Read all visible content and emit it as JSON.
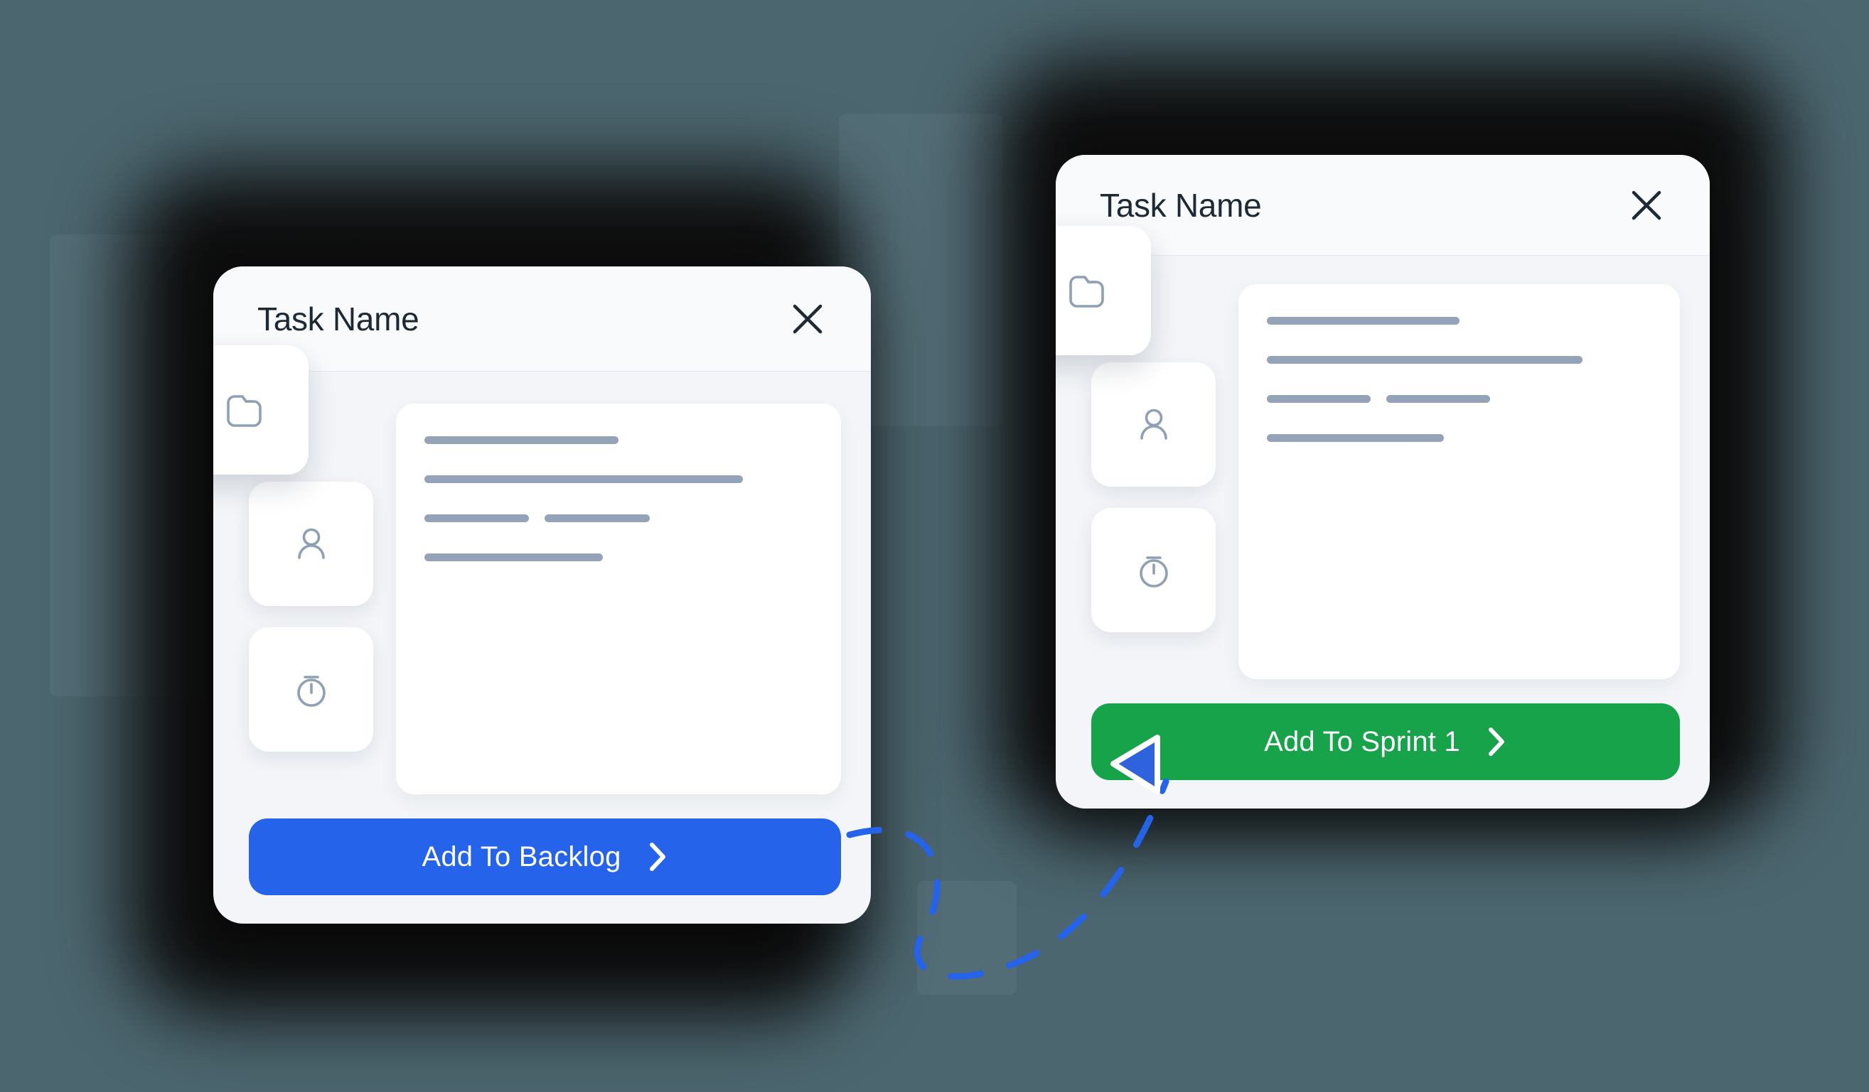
{
  "background": {
    "color": "#4c666f",
    "glow_color": "#0d0d0d"
  },
  "colors": {
    "card_surface": "#f3f5f8",
    "panel_white": "#ffffff",
    "title_text": "#1d2a35",
    "skeleton_line": "#94a3b8",
    "icon_stroke": "#8ea0b5",
    "primary_blue": "#2563eb",
    "primary_green": "#17a34a",
    "cursor_blue": "#2f62dd",
    "drag_path": "#2563eb"
  },
  "cards": [
    {
      "id": "backlog-card",
      "header": {
        "title": "Task Name",
        "close_icon": "close-x-icon",
        "close_label": "X"
      },
      "icon_rail": [
        {
          "name": "folder-icon",
          "label": "Folder"
        },
        {
          "name": "person-icon",
          "label": "Assignee"
        },
        {
          "name": "timer-icon",
          "label": "Estimate"
        }
      ],
      "content_lines": [
        [
          {
            "width_pct": 50
          }
        ],
        [
          {
            "width_pct": 82
          }
        ],
        [
          {
            "width_pct": 27
          },
          {
            "gap_pct": 4
          },
          {
            "width_pct": 27
          }
        ],
        [
          {
            "width_pct": 46
          }
        ]
      ],
      "cta": {
        "label": "Add To Backlog",
        "chevron_icon": "chevron-right-icon",
        "color": "#2563eb"
      }
    },
    {
      "id": "sprint-card",
      "header": {
        "title": "Task Name",
        "close_icon": "close-x-icon",
        "close_label": "X"
      },
      "icon_rail": [
        {
          "name": "folder-icon",
          "label": "Folder"
        },
        {
          "name": "person-icon",
          "label": "Assignee"
        },
        {
          "name": "timer-icon",
          "label": "Estimate"
        }
      ],
      "content_lines": [
        [
          {
            "width_pct": 50
          }
        ],
        [
          {
            "width_pct": 82
          }
        ],
        [
          {
            "width_pct": 27
          },
          {
            "gap_pct": 4
          },
          {
            "width_pct": 27
          }
        ],
        [
          {
            "width_pct": 46
          }
        ]
      ],
      "cta": {
        "label": "Add To Sprint 1",
        "chevron_icon": "chevron-right-icon",
        "color": "#17a34a"
      }
    }
  ],
  "annotation": {
    "drag_path_icon": "dashed-curved-arrow-path",
    "cursor_icon": "pointer-triangle-cursor"
  }
}
